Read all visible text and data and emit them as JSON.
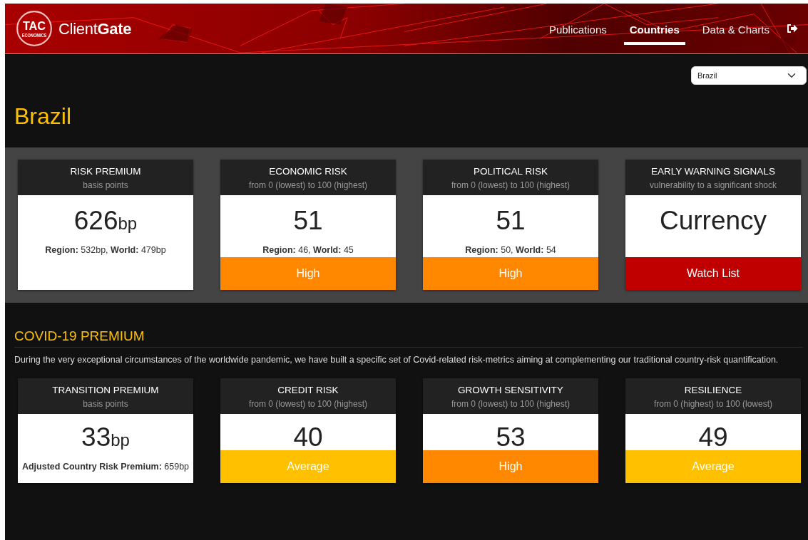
{
  "brand": {
    "logo_text": "TAC",
    "logo_subtext": "ECONOMICS",
    "name_light": "Client",
    "name_bold": "Gate"
  },
  "nav": [
    {
      "label": "Publications",
      "selected": false
    },
    {
      "label": "Countries",
      "selected": true
    },
    {
      "label": "Data & Charts",
      "selected": false
    }
  ],
  "country_select": {
    "value": "Brazil"
  },
  "page_title": "Brazil",
  "risk_cards": [
    {
      "title": "RISK PREMIUM",
      "subtitle": "basis points",
      "value": "626",
      "unit": "bp",
      "note": "**Region:** 532bp, **World:** 479bp"
    },
    {
      "title": "ECONOMIC RISK",
      "subtitle": "from 0 (lowest) to 100 (highest)",
      "value": "51",
      "note": "**Region:** 46, **World:** 45",
      "rating": {
        "label": "High",
        "color": "#ff8800"
      }
    },
    {
      "title": "POLITICAL RISK",
      "subtitle": "from 0 (lowest) to 100 (highest)",
      "value": "51",
      "note": "**Region:** 50, **World:** 54",
      "rating": {
        "label": "High",
        "color": "#ff8800"
      }
    },
    {
      "title": "EARLY WARNING SIGNALS",
      "subtitle": "vulnerability to a significant shock",
      "value": "Currency",
      "rating": {
        "label": "Watch List",
        "color": "#c00000"
      }
    }
  ],
  "covid": {
    "heading": "COVID-19 PREMIUM",
    "description": "During the very exceptional circumstances of the worldwide pandemic, we have built a specific set of Covid-related risk-metrics aiming at complementing our traditional country-risk quantification.",
    "cards": [
      {
        "title": "TRANSITION PREMIUM",
        "subtitle": "basis points",
        "value": "33",
        "unit": "bp",
        "note": "**Adjusted Country Risk Premium:** 659bp"
      },
      {
        "title": "CREDIT RISK",
        "subtitle": "from 0 (lowest) to 100 (highest)",
        "value": "40",
        "rating": {
          "label": "Average",
          "color": "#ffc000"
        }
      },
      {
        "title": "GROWTH SENSITIVITY",
        "subtitle": "from 0 (lowest) to 100 (highest)",
        "value": "53",
        "rating": {
          "label": "High",
          "color": "#ff8800"
        }
      },
      {
        "title": "RESILIENCE",
        "subtitle": "from 0 (highest) to 100 (lowest)",
        "value": "49",
        "rating": {
          "label": "Average",
          "color": "#ffc000"
        }
      }
    ]
  }
}
